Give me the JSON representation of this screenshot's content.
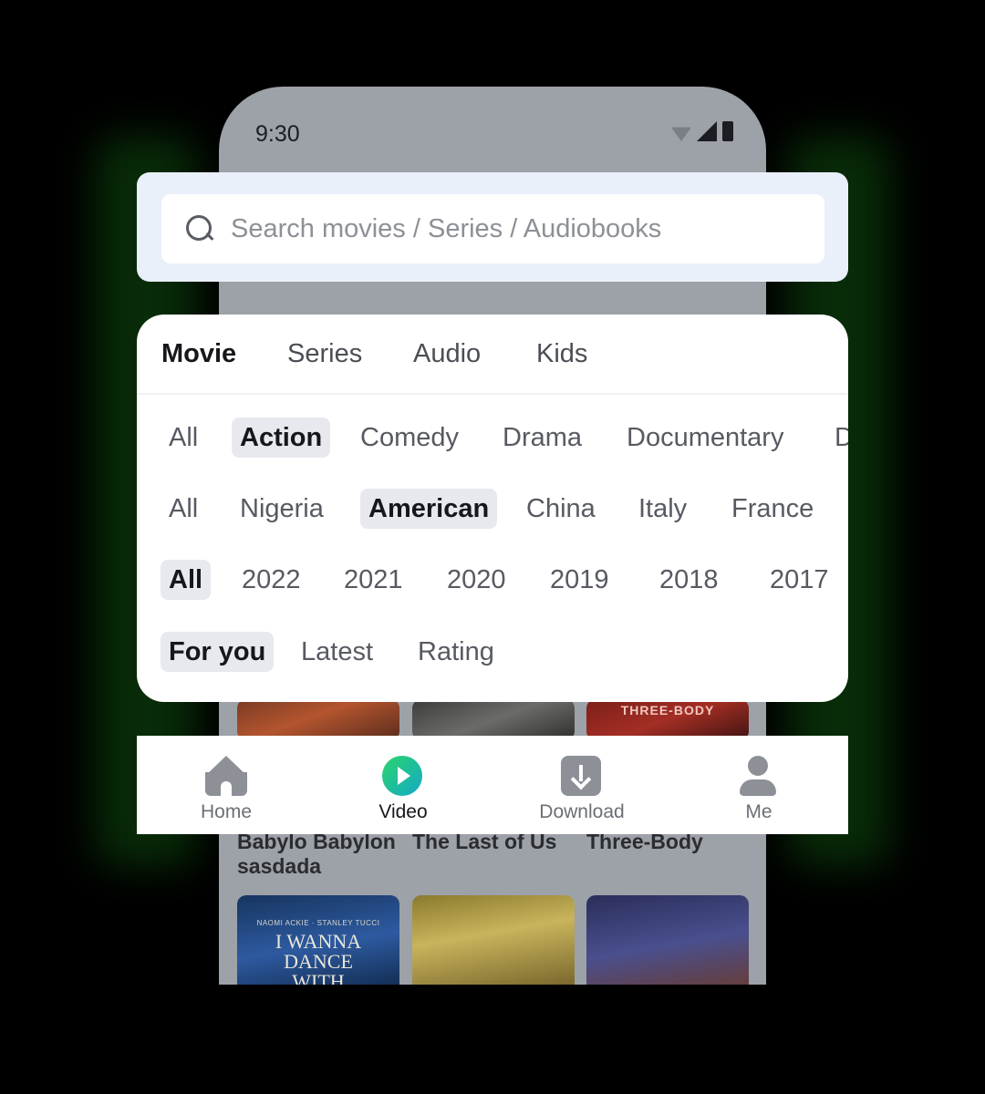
{
  "status_bar": {
    "time": "9:30"
  },
  "search": {
    "placeholder": "Search movies / Series / Audiobooks"
  },
  "tabs": [
    {
      "label": "Movie",
      "active": true
    },
    {
      "label": "Series",
      "active": false
    },
    {
      "label": "Audio",
      "active": false
    },
    {
      "label": "Kids",
      "active": false
    }
  ],
  "filters": {
    "genre": [
      "All",
      "Action",
      "Comedy",
      "Drama",
      "Documentary",
      "D"
    ],
    "genre_selected": "Action",
    "region": [
      "All",
      "Nigeria",
      "American",
      "China",
      "Italy",
      "France"
    ],
    "region_selected": "American",
    "year": [
      "All",
      "2022",
      "2021",
      "2020",
      "2019",
      "2018",
      "2017"
    ],
    "year_selected": "All",
    "sort": [
      "For you",
      "Latest",
      "Rating"
    ],
    "sort_selected": "For you"
  },
  "background_posters": {
    "row1": [
      {
        "title": "Babylo Babylon sasdada",
        "caption": ""
      },
      {
        "title": "The Last of Us",
        "caption": ""
      },
      {
        "title": "Three-Body",
        "caption": "THREE-BODY"
      }
    ],
    "row2_captions": {
      "dance_top": "NAOMI ACKIE · STANLEY TUCCI",
      "dance_title": "I WANNA DANCE WITH SOMEBODY"
    }
  },
  "bottom_nav": [
    {
      "label": "Home",
      "icon": "home-icon",
      "active": false
    },
    {
      "label": "Video",
      "icon": "video-play-icon",
      "active": true
    },
    {
      "label": "Download",
      "icon": "download-icon",
      "active": false
    },
    {
      "label": "Me",
      "icon": "person-icon",
      "active": false
    }
  ],
  "colors": {
    "accent_green": "#2bd56a",
    "accent_teal": "#14a9c8",
    "search_card_bg": "#eaf0fa",
    "chip_active_bg": "#e7e9ee"
  }
}
